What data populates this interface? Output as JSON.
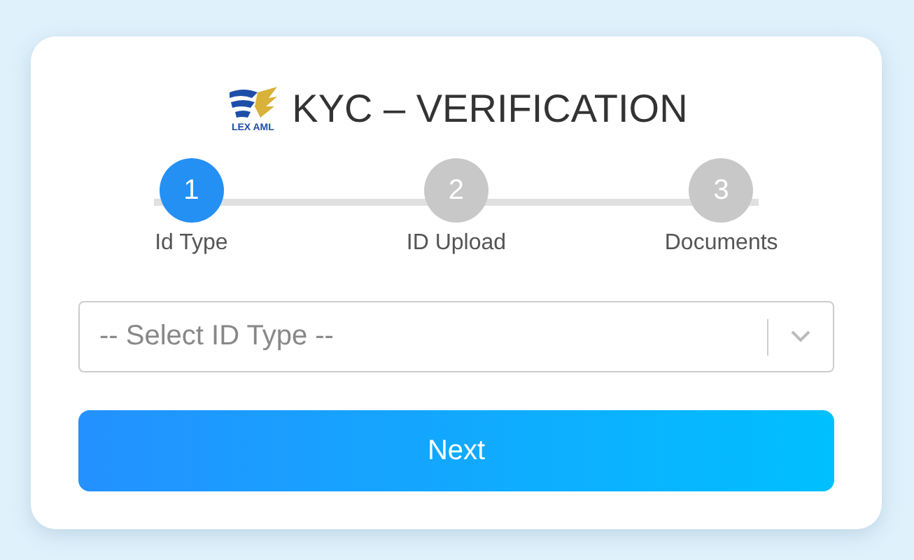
{
  "logo_text": "LEX AML",
  "title": "KYC – VERIFICATION",
  "steps": [
    {
      "number": "1",
      "label": "Id Type",
      "selected": true
    },
    {
      "number": "2",
      "label": "ID Upload",
      "selected": false
    },
    {
      "number": "3",
      "label": "Documents",
      "selected": false
    }
  ],
  "select": {
    "placeholder": "-- Select ID Type --"
  },
  "next_button": "Next"
}
